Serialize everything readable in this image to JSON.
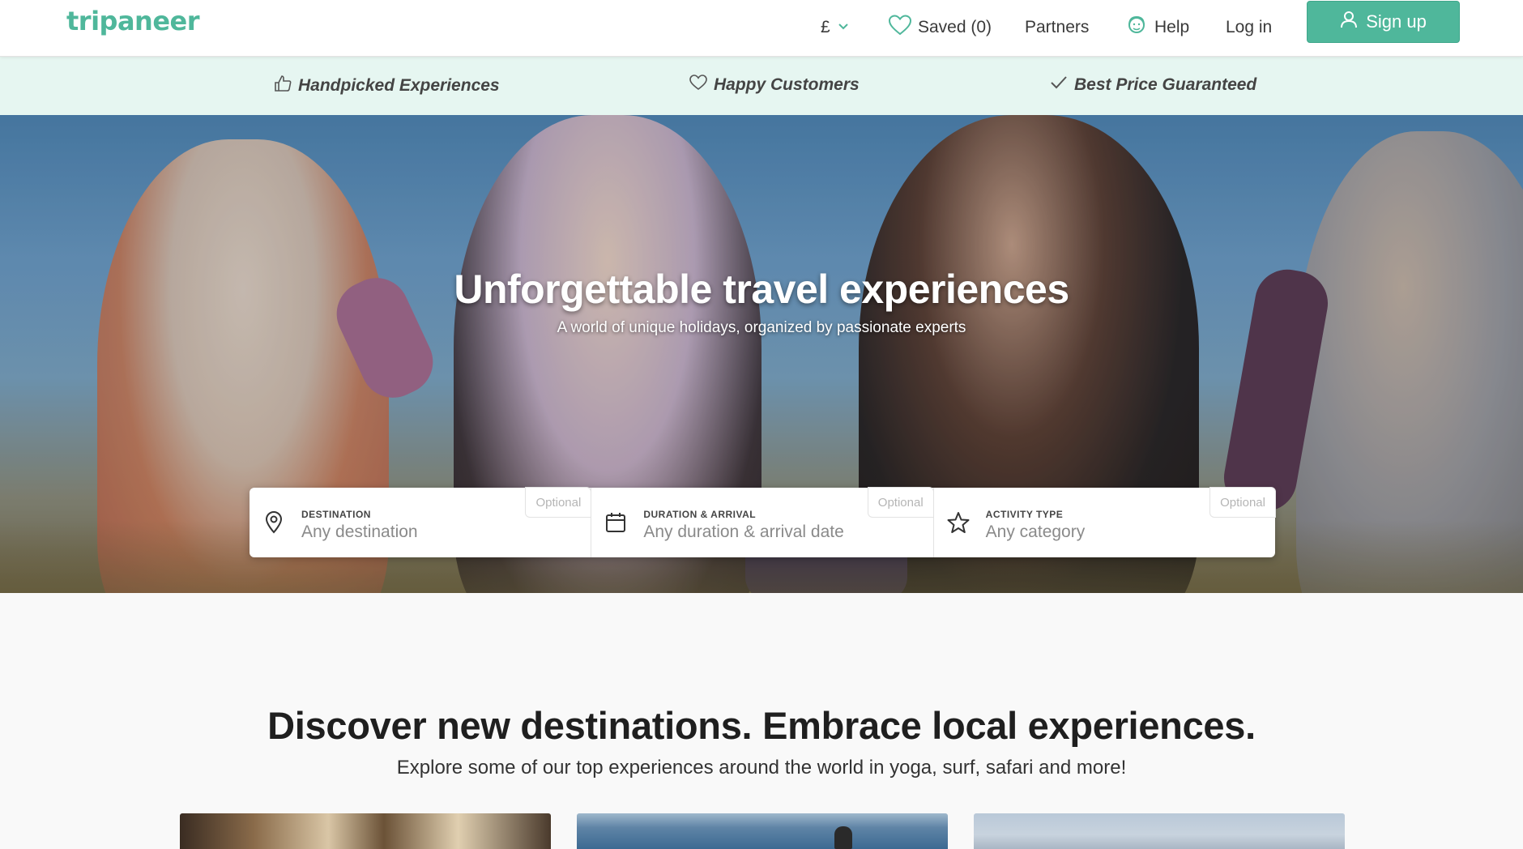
{
  "header": {
    "logo": "tripaneer",
    "currency": "£",
    "saved": "Saved (0)",
    "partners": "Partners",
    "help": "Help",
    "login": "Log in",
    "signup": "Sign up"
  },
  "trust": {
    "items": [
      {
        "label": "Handpicked Experiences",
        "icon": "thumbs-up-icon"
      },
      {
        "label": "Happy Customers",
        "icon": "heart-icon"
      },
      {
        "label": "Best Price Guaranteed",
        "icon": "check-icon"
      }
    ]
  },
  "hero": {
    "title": "Unforgettable travel experiences",
    "subtitle": "A world of unique holidays, organized by passionate experts"
  },
  "search": {
    "fields": [
      {
        "label": "DESTINATION",
        "value": "Any destination",
        "optional": "Optional",
        "icon": "location-pin-icon"
      },
      {
        "label": "DURATION & ARRIVAL",
        "value": "Any duration & arrival date",
        "optional": "Optional",
        "icon": "calendar-icon"
      },
      {
        "label": "ACTIVITY TYPE",
        "value": "Any category",
        "optional": "Optional",
        "icon": "star-icon"
      }
    ]
  },
  "discover": {
    "title": "Discover new destinations. Embrace local experiences.",
    "subtitle": "Explore some of our top experiences around the world in yoga, surf, safari and more!"
  },
  "colors": {
    "brand": "#4fb79b",
    "trustbar": "#e6f6f1"
  }
}
